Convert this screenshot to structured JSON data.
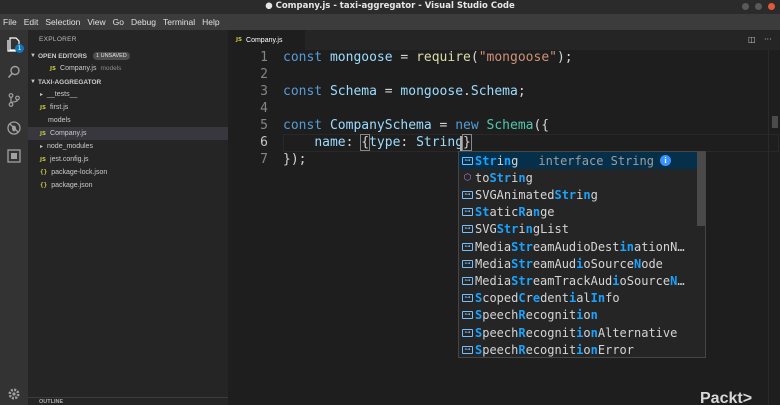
{
  "window": {
    "title": "● Company.js - taxi-aggregator - Visual Studio Code"
  },
  "menu": [
    "File",
    "Edit",
    "Selection",
    "View",
    "Go",
    "Debug",
    "Terminal",
    "Help"
  ],
  "activity_bar": {
    "items": [
      "files-icon",
      "search-icon",
      "source-control-icon",
      "debug-icon",
      "extensions-icon"
    ],
    "files_badge": "1",
    "bottom": "gear-icon"
  },
  "sidebar": {
    "header": "EXPLORER",
    "open_editors": {
      "title": "OPEN EDITORS",
      "badge": "1 UNSAVED",
      "items": [
        {
          "type": "JS",
          "name": "Company.js",
          "folder": "models"
        }
      ]
    },
    "project": {
      "title": "TAXI-AGGREGATOR",
      "items": [
        {
          "kind": "folder",
          "name": "__tests__",
          "open": true
        },
        {
          "kind": "js",
          "name": "first.js"
        },
        {
          "kind": "folder-plain",
          "name": "models"
        },
        {
          "kind": "js",
          "name": "Company.js",
          "active": true
        },
        {
          "kind": "folder",
          "name": "node_modules",
          "open": false
        },
        {
          "kind": "js",
          "name": "jest.config.js"
        },
        {
          "kind": "json",
          "name": "package-lock.json"
        },
        {
          "kind": "json",
          "name": "package.json"
        }
      ]
    },
    "outline": "OUTLINE"
  },
  "editor": {
    "tab": {
      "type": "JS",
      "label": "Company.js"
    },
    "tab_actions": [
      "split-editor-icon",
      "more-actions-icon"
    ],
    "cursor_line": 6,
    "lines": [
      {
        "num": "1",
        "text": "const mongoose = require(\"mongoose\");"
      },
      {
        "num": "2",
        "text": ""
      },
      {
        "num": "3",
        "text": "const Schema = mongoose.Schema;"
      },
      {
        "num": "4",
        "text": ""
      },
      {
        "num": "5",
        "text": "const CompanySchema = new Schema({"
      },
      {
        "num": "6",
        "text": "    name: {type: String}"
      },
      {
        "num": "7",
        "text": "});"
      }
    ]
  },
  "suggest": {
    "selected_detail": "interface String",
    "items": [
      {
        "icon": "interface",
        "label": "String"
      },
      {
        "icon": "method",
        "label": "toString"
      },
      {
        "icon": "interface",
        "label": "SVGAnimatedString"
      },
      {
        "icon": "interface",
        "label": "StaticRange"
      },
      {
        "icon": "interface",
        "label": "SVGStringList"
      },
      {
        "icon": "interface",
        "label": "MediaStreamAudioDestinationN…"
      },
      {
        "icon": "interface",
        "label": "MediaStreamAudioSourceNode"
      },
      {
        "icon": "interface",
        "label": "MediaStreamTrackAudioSourceN…"
      },
      {
        "icon": "interface",
        "label": "ScopedCredentialInfo"
      },
      {
        "icon": "interface",
        "label": "SpeechRecognition"
      },
      {
        "icon": "interface",
        "label": "SpeechRecognitionAlternative"
      },
      {
        "icon": "interface",
        "label": "SpeechRecognitionError"
      }
    ]
  },
  "watermark": "Packt>",
  "colors": {
    "accent": "#1177bb",
    "selection": "#062f4a",
    "match": "#18a3ff"
  }
}
